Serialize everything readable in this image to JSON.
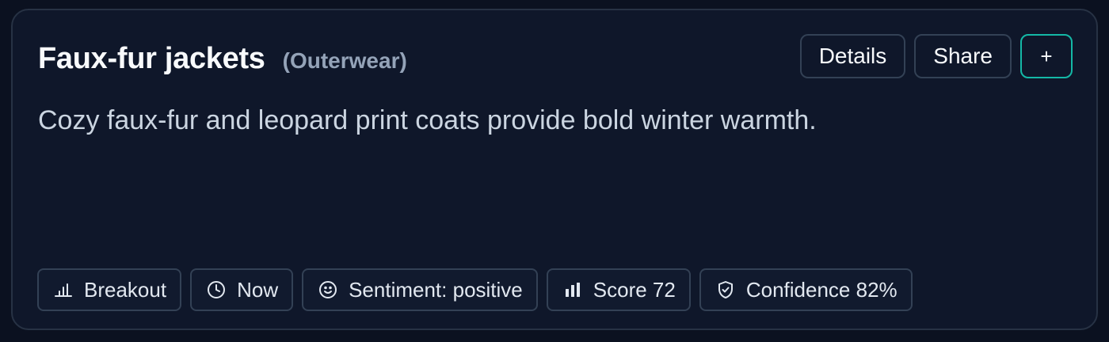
{
  "card": {
    "title": "Faux-fur jackets",
    "category": "(Outerwear)",
    "description": "Cozy faux-fur and leopard print coats provide bold winter warmth.",
    "actions": {
      "details_label": "Details",
      "share_label": "Share",
      "add_label": "+"
    },
    "chips": [
      {
        "icon": "bar-chart-icon",
        "label": "Breakout"
      },
      {
        "icon": "clock-icon",
        "label": "Now"
      },
      {
        "icon": "smile-icon",
        "label": "Sentiment: positive"
      },
      {
        "icon": "score-bars-icon",
        "label": "Score 72"
      },
      {
        "icon": "shield-check-icon",
        "label": "Confidence 82%"
      }
    ]
  },
  "colors": {
    "background": "#0b1120",
    "card": "#0f172a",
    "border": "#334155",
    "accent": "#14b8a6",
    "title": "#f8fafc",
    "muted": "#94a3b8"
  }
}
